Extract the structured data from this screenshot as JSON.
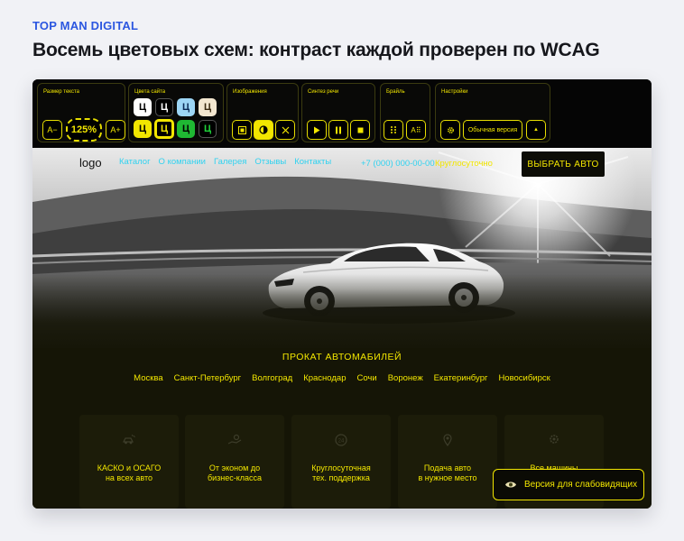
{
  "page": {
    "brand": "TOP MAN DIGITAL",
    "headline": "Восемь цветовых схем: контраст каждой проверен по WCAG"
  },
  "toolbar": {
    "text_size": {
      "label": "Размер текста",
      "decrease": "A−",
      "value": "125%",
      "increase": "A+"
    },
    "colors": {
      "label": "Цвета сайта",
      "swatch_glyph": "Ц",
      "swatches": [
        {
          "bg": "#ffffff",
          "fg": "#000000"
        },
        {
          "bg": "#000000",
          "fg": "#ffffff"
        },
        {
          "bg": "#9dd6f5",
          "fg": "#0b2a55"
        },
        {
          "bg": "#f3e7cf",
          "fg": "#3a2a10"
        },
        {
          "bg": "#f2e600",
          "fg": "#000000"
        },
        {
          "bg": "#000000",
          "fg": "#f2e600"
        },
        {
          "bg": "#1fb833",
          "fg": "#000000"
        },
        {
          "bg": "#000000",
          "fg": "#1fd23a"
        }
      ]
    },
    "images": {
      "label": "Изображения"
    },
    "speech": {
      "label": "Синтез речи"
    },
    "braille": {
      "label": "Брайль",
      "toggle": "A⠿"
    },
    "settings": {
      "label": "Настройки",
      "normal_version": "Обычная версия",
      "collapse": "▲"
    }
  },
  "nav": {
    "logo": "logo",
    "links": [
      "Каталог",
      "О компании",
      "Галерея",
      "Отзывы",
      "Контакты"
    ],
    "phone": "+7 (000) 000-00-00",
    "hours": "Круглосуточно",
    "cta": "ВЫБРАТЬ АВТО"
  },
  "hero": {
    "title": "ПРОКАТ АВТОМАБИЛЕЙ",
    "cities": [
      "Москва",
      "Санкт-Петербург",
      "Волгоград",
      "Краснодар",
      "Сочи",
      "Воронеж",
      "Екатеринбург",
      "Новосибирск"
    ]
  },
  "features": [
    {
      "icon": "car-crash-icon",
      "line1": "КАСКО и ОСАГО",
      "line2": "на всех авто"
    },
    {
      "icon": "hand-money-icon",
      "line1": "От эконом до",
      "line2": "бизнес-класса"
    },
    {
      "icon": "clock-24-icon",
      "line1": "Круглосуточная",
      "line2": "тех. поддержка"
    },
    {
      "icon": "map-pin-icon",
      "line1": "Подача авто",
      "line2": "в нужное место"
    },
    {
      "icon": "gear-car-icon",
      "line1": "Все машины",
      "line2": ""
    }
  ],
  "low_vision_button": "Версия для слабовидящих",
  "colors": {
    "accent": "#f2e600",
    "link": "#2fd2f0",
    "brand": "#2c57e0"
  }
}
